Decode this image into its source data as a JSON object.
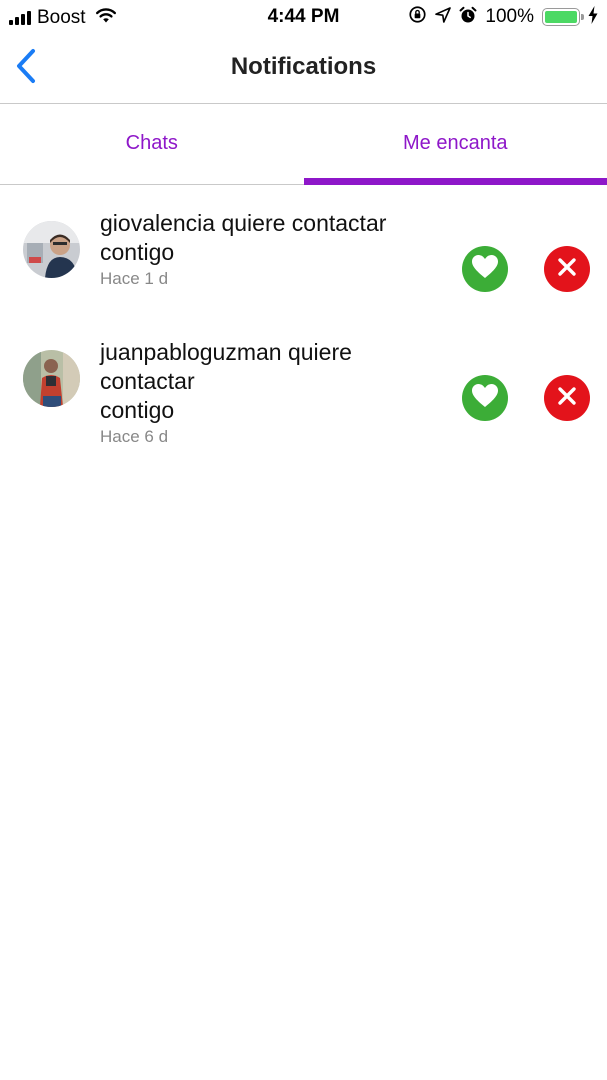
{
  "status_bar": {
    "carrier": "Boost",
    "time": "4:44 PM",
    "battery_percent": "100%",
    "battery_level": 1.0,
    "signal_bars": 4,
    "icons": [
      "signal-icon",
      "wifi-icon",
      "orientation-lock-icon",
      "location-arrow-icon",
      "alarm-icon",
      "battery-icon",
      "charging-bolt-icon"
    ]
  },
  "header": {
    "back_icon": "chevron-left-icon",
    "title": "Notifications"
  },
  "tabs": [
    {
      "label": "Chats",
      "active": false
    },
    {
      "label": "Me encanta",
      "active": true
    }
  ],
  "notifications": [
    {
      "line1": "giovalencia quiere contactar",
      "line2": "contigo",
      "time": "Hace 1 d"
    },
    {
      "line1": "juanpabloguzman quiere contactar",
      "line2": "contigo",
      "time": "Hace 6 d"
    }
  ],
  "colors": {
    "accent": "#8e17c9",
    "accept": "#3cad37",
    "reject": "#e3131b",
    "back": "#1a7cf5",
    "battery": "#4cd964"
  }
}
